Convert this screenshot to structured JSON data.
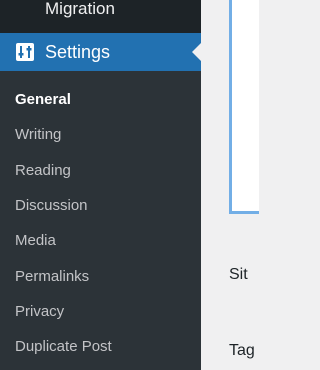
{
  "sidebar": {
    "migration_label": "Migration",
    "settings_label": "Settings",
    "submenu": [
      {
        "label": "General",
        "active": true
      },
      {
        "label": "Writing"
      },
      {
        "label": "Reading"
      },
      {
        "label": "Discussion"
      },
      {
        "label": "Media"
      },
      {
        "label": "Permalinks"
      },
      {
        "label": "Privacy"
      },
      {
        "label": "Duplicate Post"
      }
    ]
  },
  "content": {
    "row1_label_clipped": "Sit",
    "row2_label_clipped": "Tag"
  },
  "colors": {
    "sidebar_bg": "#1d2327",
    "submenu_bg": "#2c3338",
    "active_bg": "#2271b1",
    "panel_border": "#72aee6"
  }
}
